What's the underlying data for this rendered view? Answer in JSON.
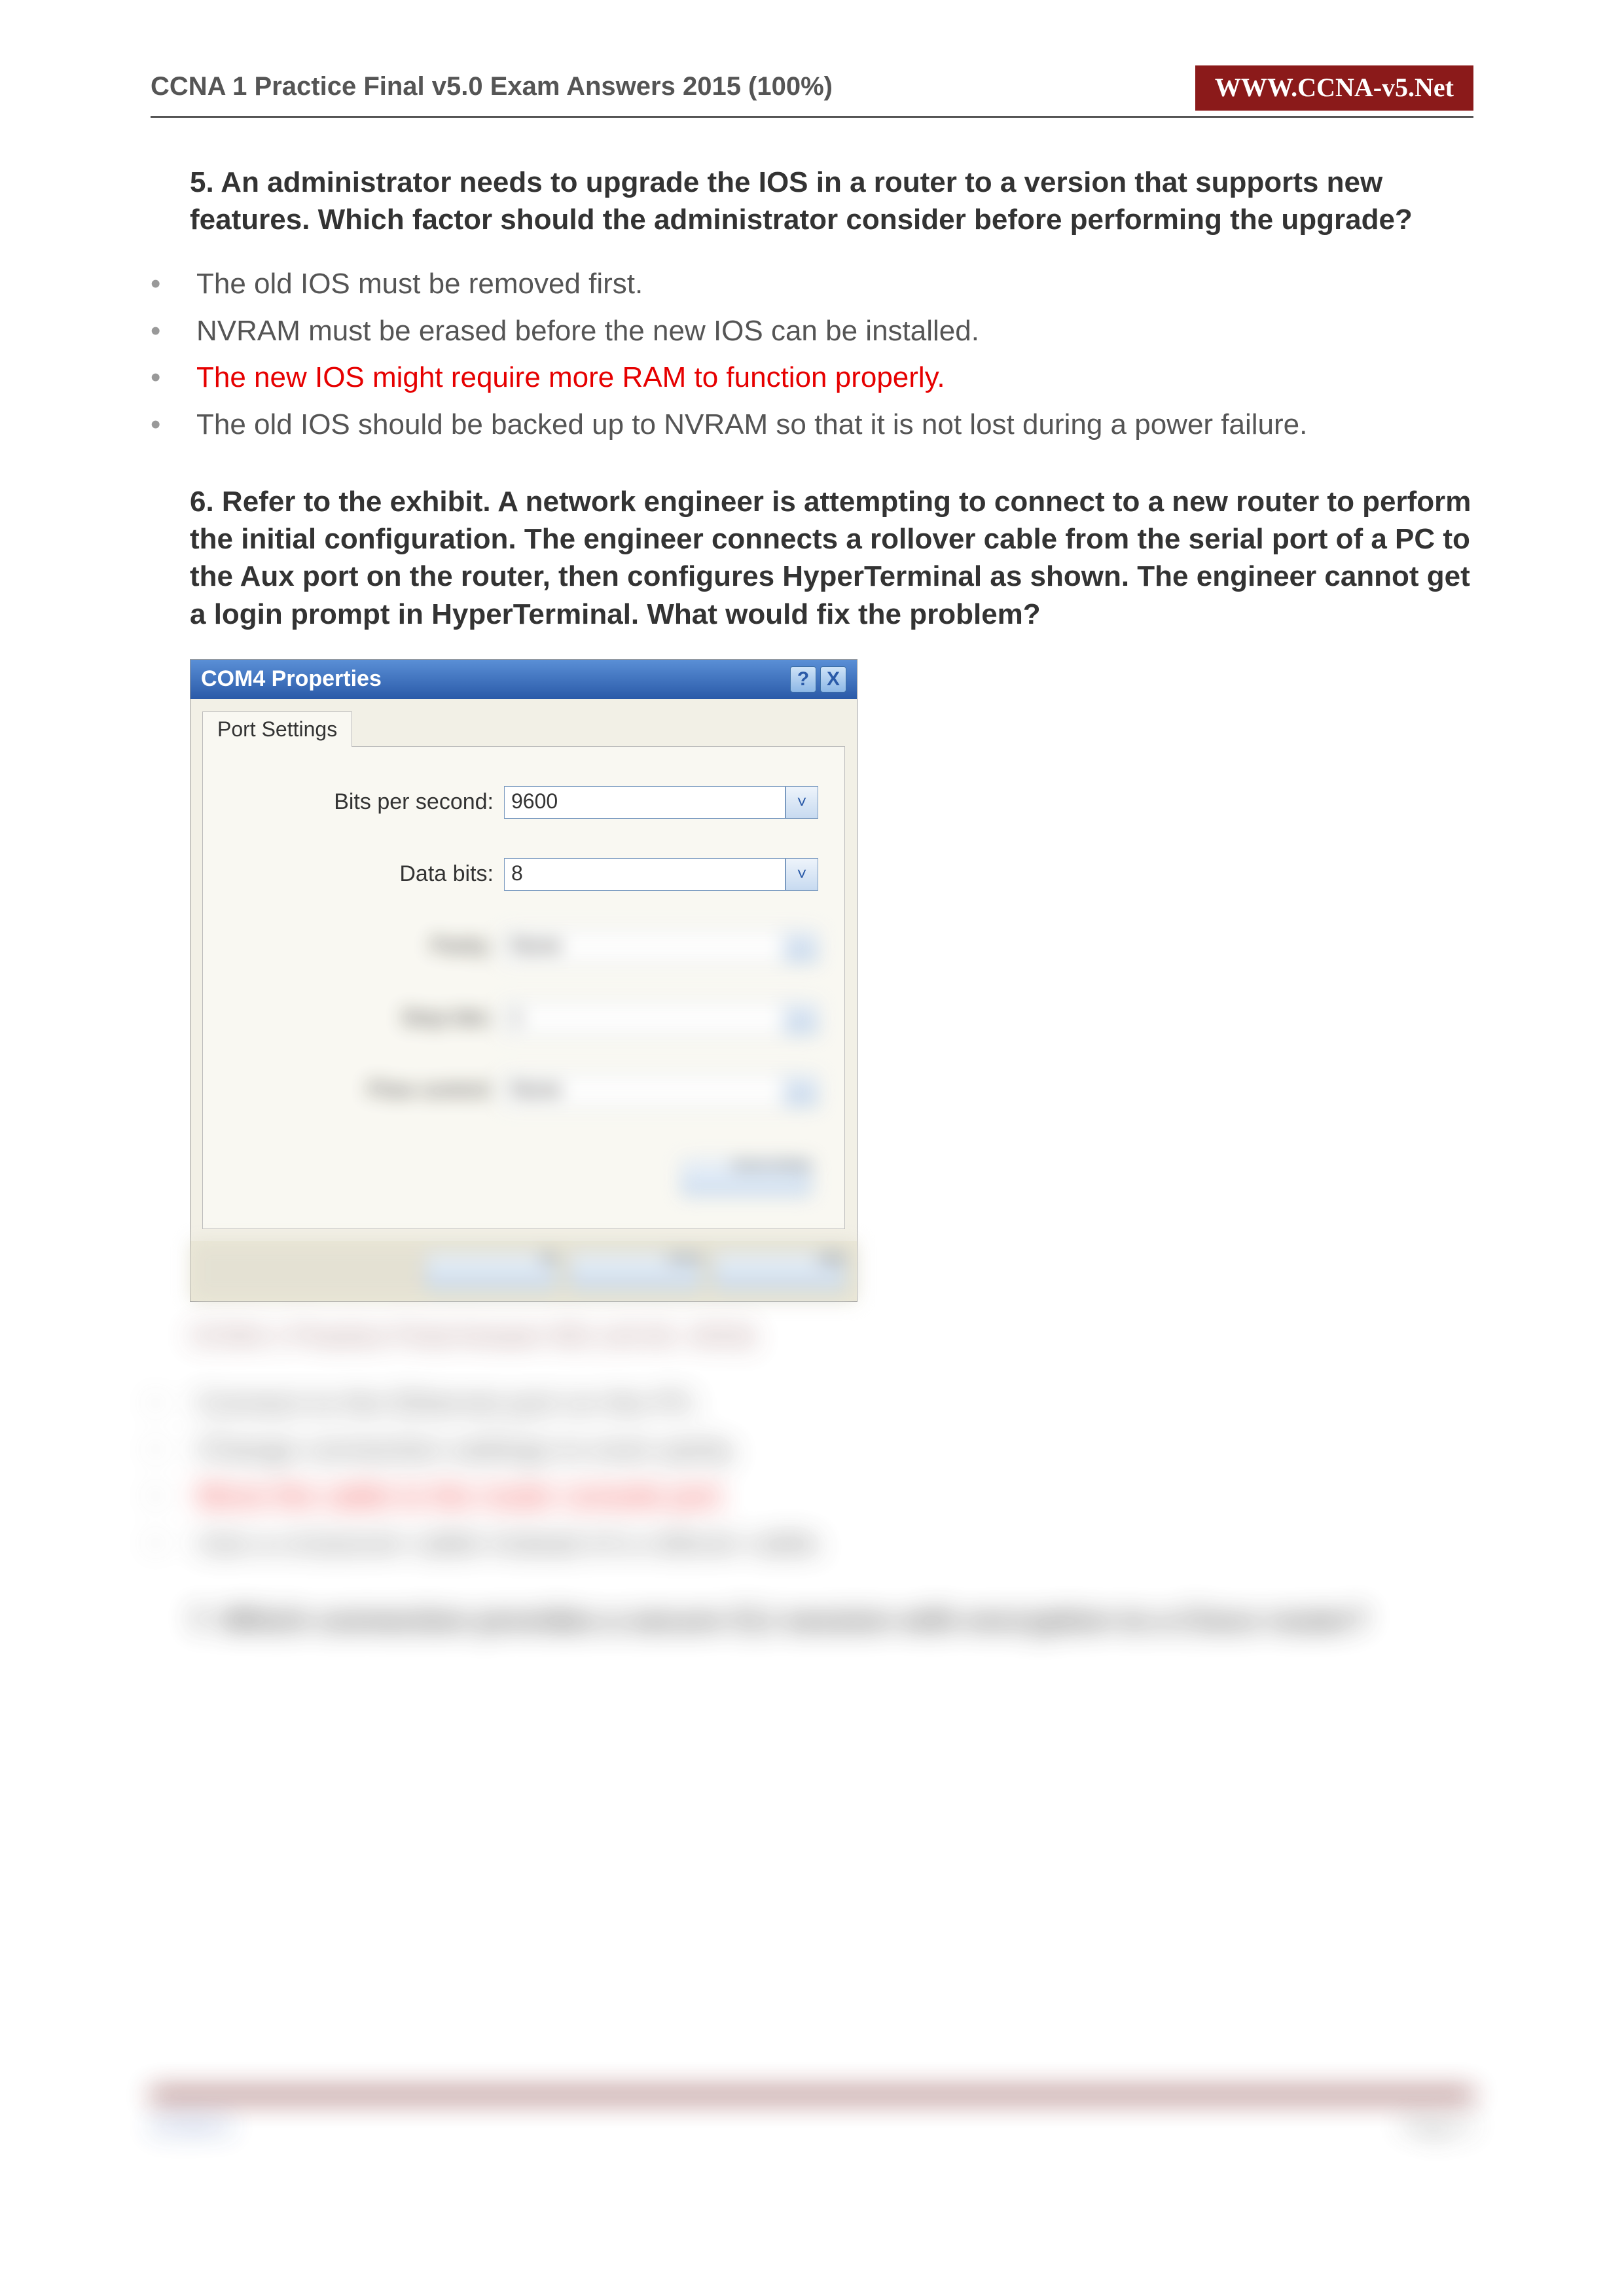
{
  "header": {
    "title": "CCNA 1 Practice Final v5.0 Exam Answers 2015 (100%)",
    "site": "WWW.CCNA-v5.Net"
  },
  "q5": {
    "text": "5. An administrator needs to upgrade the IOS in a router to a version that supports new features. Which factor should the administrator consider before performing the upgrade?",
    "answers": [
      "The old IOS must be removed first.",
      "NVRAM must be erased before the new IOS can be installed.",
      "The new IOS might require more RAM to function properly.",
      "The old IOS should be backed up to NVRAM so that it is not lost during a power failure."
    ],
    "correct_index": 2
  },
  "q6": {
    "text": "6. Refer to the exhibit. A network engineer is attempting to connect to a new router to perform the initial configuration. The engineer connects a rollover cable from the serial port of a PC to the Aux port on the router, then configures HyperTerminal as shown. The engineer cannot get a login prompt in HyperTerminal. What would fix the problem?",
    "exhibit": {
      "title": "COM4 Properties",
      "tab": "Port Settings",
      "fields": {
        "bits_per_second": {
          "label": "Bits per second:",
          "value": "9600"
        },
        "data_bits": {
          "label": "Data bits:",
          "value": "8"
        },
        "parity": {
          "label": "Parity:",
          "value": "None"
        },
        "stop_bits": {
          "label": "Stop bits:",
          "value": "1"
        },
        "flow_control": {
          "label": "Flow control:",
          "value": "None"
        }
      },
      "restore_button": "Restore Defaults",
      "ok": "OK",
      "cancel": "Cancel",
      "apply": "Apply"
    },
    "caption": "CCNA 1 Practice Final Answer 001 (v5.02, 2015)",
    "answers": [
      "Connect to the Ethernet port on the PC.",
      "Change connection settings to even parity.",
      "Move the cable to the router console port.",
      "Use a crossover cable instead of a rollover cable."
    ],
    "correct_index": 2
  },
  "q7": {
    "text": "7. Which connection provides a secure CLI session with encryption to a Cisco router?"
  },
  "footer": {
    "left": "CCNA 5",
    "right": "Page 2"
  },
  "icons": {
    "help": "?",
    "close": "X",
    "chevron": "˅"
  }
}
